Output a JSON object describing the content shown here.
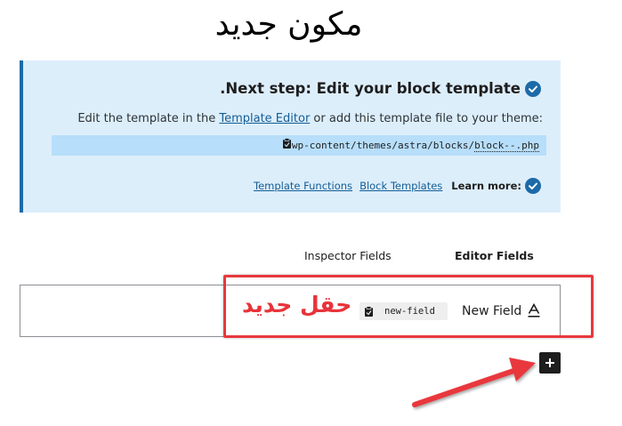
{
  "page": {
    "title": "مكون جديد"
  },
  "notice": {
    "heading": ".Next step: Edit your block template",
    "line_prefix": "Edit the template in the ",
    "template_editor_link": "Template Editor",
    "line_suffix": " or add this template file to your theme:",
    "path_text": "wp-content/themes/astra/blocks/",
    "path_file": "block--.php",
    "learn_more_label": "Learn more:",
    "link_block_templates": "Block Templates",
    "link_template_functions": "Template Functions"
  },
  "tabs": {
    "editor_fields": "Editor Fields",
    "inspector_fields": "Inspector Fields"
  },
  "field": {
    "label": "New Field",
    "slug": "new-field",
    "type_icon": "text-field-icon"
  },
  "annotation": {
    "text": "حقل جديد",
    "color": "#e8333a"
  },
  "actions": {
    "add_icon": "plus-icon"
  },
  "colors": {
    "accent": "#1d6aa8",
    "notice_bg": "#ddeefb",
    "path_bg": "#b7defa",
    "annotation_red": "#e8383e"
  }
}
